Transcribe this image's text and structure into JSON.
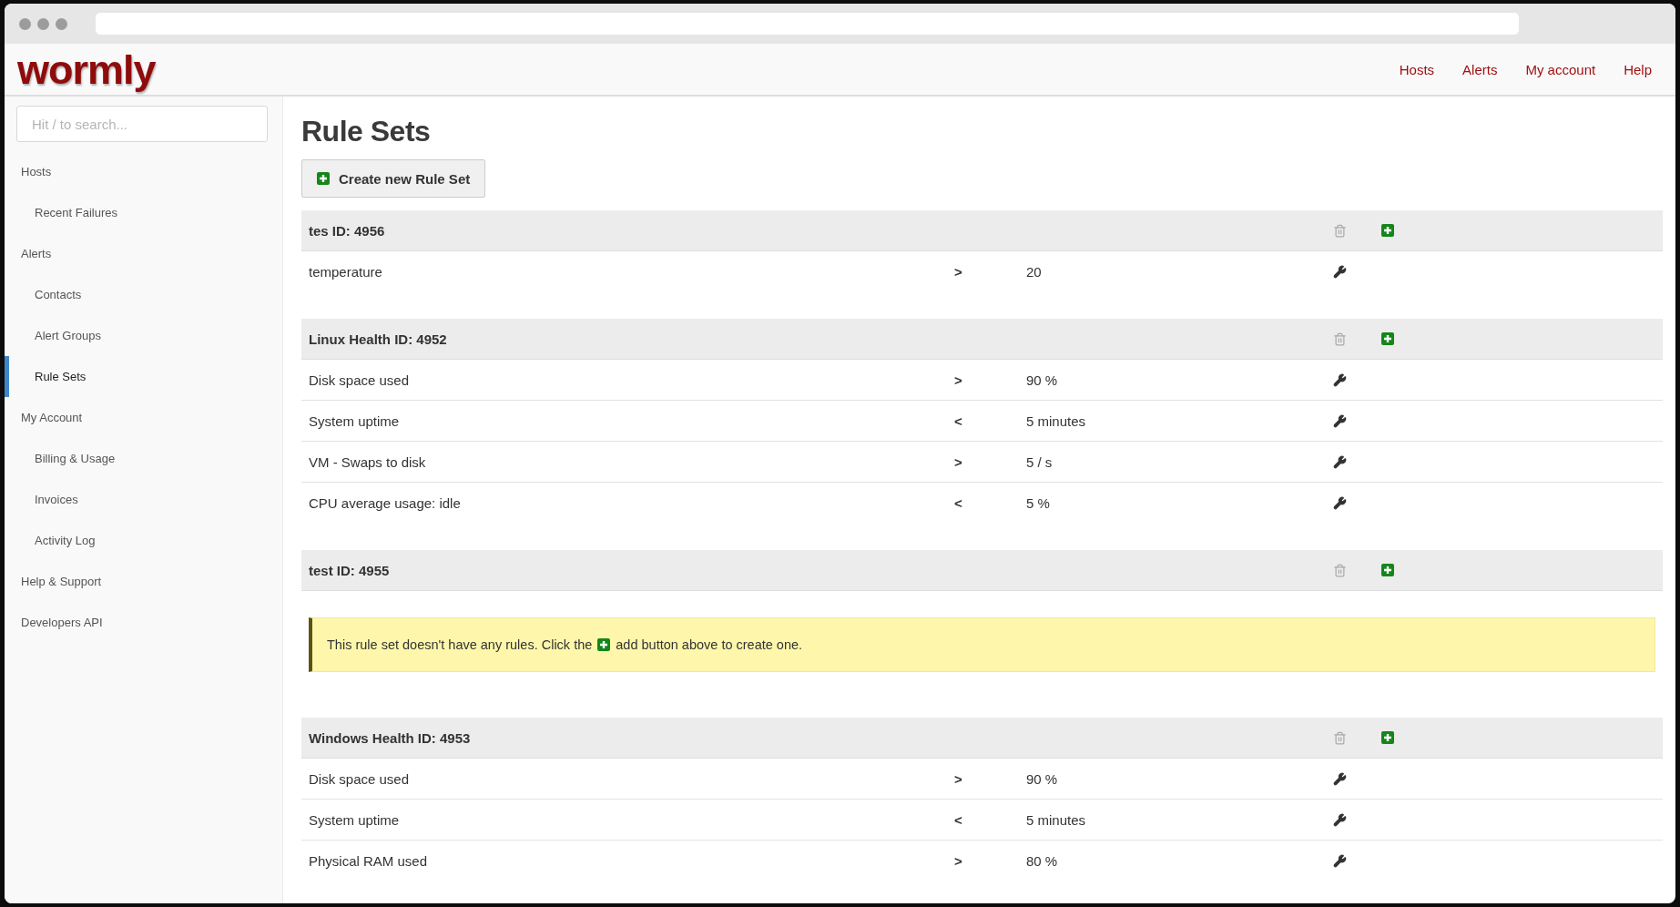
{
  "logo": "wormly",
  "nav": [
    "Hosts",
    "Alerts",
    "My account",
    "Help"
  ],
  "search": {
    "placeholder": "Hit / to search..."
  },
  "sidebar": {
    "items": [
      {
        "label": "Hosts",
        "selected": false,
        "children": [
          {
            "label": "Recent Failures",
            "selected": false
          }
        ]
      },
      {
        "label": "Alerts",
        "selected": false,
        "children": [
          {
            "label": "Contacts",
            "selected": false
          },
          {
            "label": "Alert Groups",
            "selected": false
          },
          {
            "label": "Rule Sets",
            "selected": true
          }
        ]
      },
      {
        "label": "My Account",
        "selected": false,
        "children": [
          {
            "label": "Billing & Usage",
            "selected": false
          },
          {
            "label": "Invoices",
            "selected": false
          },
          {
            "label": "Activity Log",
            "selected": false
          }
        ]
      },
      {
        "label": "Help & Support",
        "selected": false
      },
      {
        "label": "Developers API",
        "selected": false
      }
    ]
  },
  "page_title": "Rule Sets",
  "create_button": "Create new Rule Set",
  "rule_sets": [
    {
      "title": "tes ID: 4956",
      "rules": [
        {
          "metric": "temperature",
          "operator": ">",
          "threshold": "20"
        }
      ]
    },
    {
      "title": "Linux Health ID: 4952",
      "rules": [
        {
          "metric": "Disk space used",
          "operator": ">",
          "threshold": "90 %"
        },
        {
          "metric": "System uptime",
          "operator": "<",
          "threshold": "5 minutes"
        },
        {
          "metric": "VM - Swaps to disk",
          "operator": ">",
          "threshold": "5 / s"
        },
        {
          "metric": "CPU average usage: idle",
          "operator": "<",
          "threshold": "5 %"
        }
      ]
    },
    {
      "title": "test ID: 4955",
      "empty_note": {
        "before": "This rule set doesn't have any rules. Click the",
        "after": "add button above to create one."
      }
    },
    {
      "title": "Windows Health ID: 4953",
      "rules": [
        {
          "metric": "Disk space used",
          "operator": ">",
          "threshold": "90 %"
        },
        {
          "metric": "System uptime",
          "operator": "<",
          "threshold": "5 minutes"
        },
        {
          "metric": "Physical RAM used",
          "operator": ">",
          "threshold": "80 %"
        }
      ]
    }
  ]
}
